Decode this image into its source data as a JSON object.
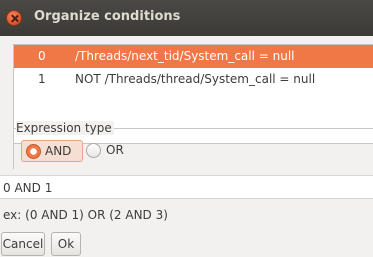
{
  "window": {
    "title": "Organize conditions"
  },
  "conditions": [
    {
      "index": "0",
      "expression": "/Threads/next_tid/System_call = null",
      "selected": true
    },
    {
      "index": "1",
      "expression": "NOT /Threads/thread/System_call = null",
      "selected": false
    }
  ],
  "expression_type": {
    "label": "Expression type",
    "options": [
      {
        "label": "AND",
        "checked": true
      },
      {
        "label": "OR",
        "checked": false
      }
    ]
  },
  "expression_value": "0 AND 1",
  "example_text": "ex: (0 AND 1) OR (2 AND 3)",
  "buttons": {
    "cancel": "Cancel",
    "ok": "Ok"
  },
  "colors": {
    "selection": "#f07746",
    "titlebar": "#3c3b37"
  }
}
